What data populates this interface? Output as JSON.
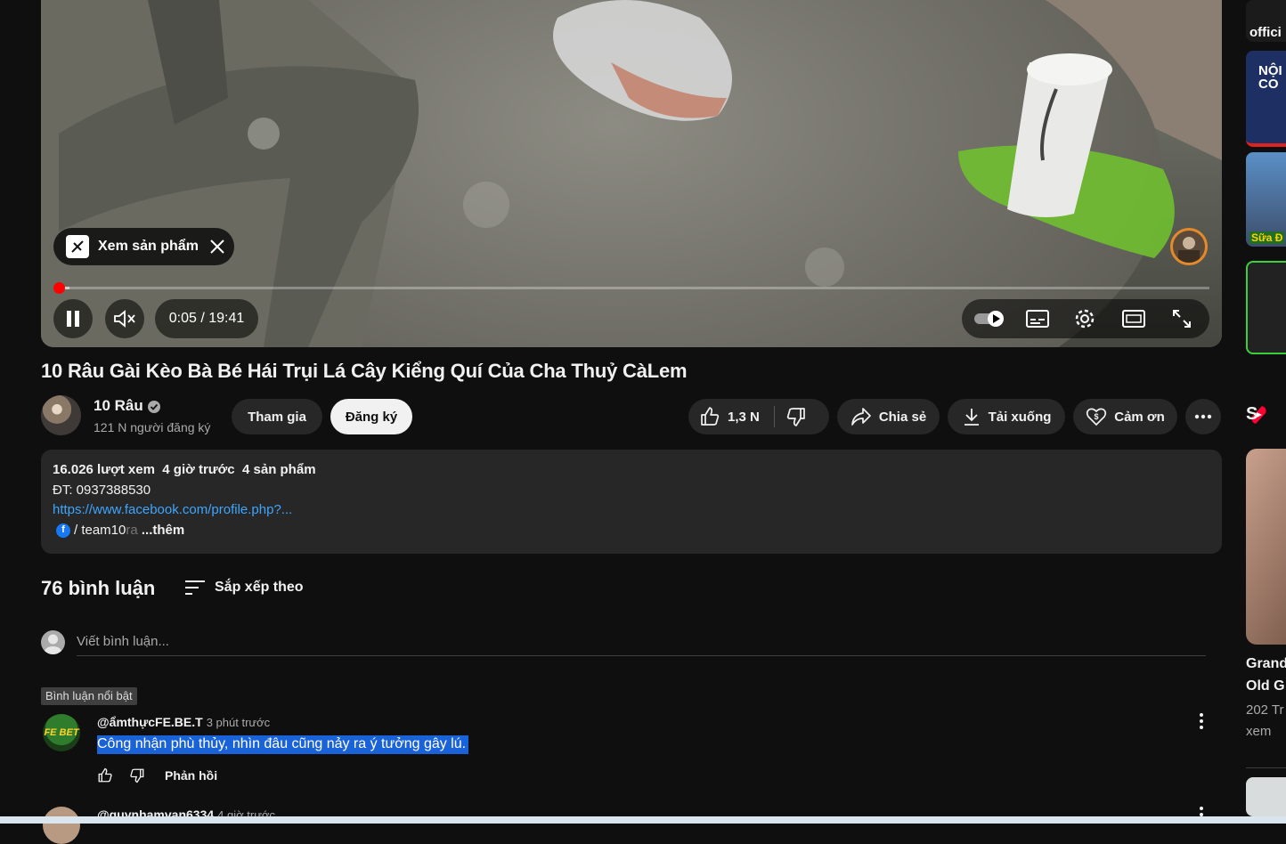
{
  "player": {
    "product_chip_label": "Xem sản phẩm",
    "time_display": "0:05 / 19:41",
    "progress": 0.0043,
    "buffered": 0.012
  },
  "video": {
    "title": "10 Râu Gài Kèo Bà Bé Hái Trụi Lá Cây Kiểng Quí Của Cha Thuỷ CàLem"
  },
  "owner": {
    "channel_name": "10 Râu",
    "subscribers": "121 N người đăng ký",
    "join_label": "Tham gia",
    "subscribe_label": "Đăng ký"
  },
  "actions": {
    "like_count": "1,3 N",
    "share_label": "Chia sẻ",
    "download_label": "Tải xuống",
    "thanks_label": "Cảm ơn"
  },
  "description": {
    "views": "16.026 lượt xem",
    "time_ago": "4 giờ trước",
    "products": "4 sản phẩm",
    "phone_line": "ĐT: 0937388530",
    "link": "https://www.facebook.com/profile.php?...",
    "handle": "/ team10",
    "handle_fade": "ra",
    "more_label": "...thêm"
  },
  "comments": {
    "count_label": "76 bình luận",
    "sort_label": "Sắp xếp theo",
    "input_placeholder": "Viết bình luận...",
    "highlight_badge": "Bình luận nổi bật",
    "items": [
      {
        "author": "@ẩmthựcFE.BE.T",
        "time": "3 phút trước",
        "text": "Công nhận phù thủy, nhìn đâu cũng nảy ra ý tưởng gây lú.",
        "reply_label": "Phản hồi",
        "avatar_text": "FE BET"
      },
      {
        "author": "@quynhamvan6334",
        "time": "4 giờ trước"
      }
    ]
  },
  "sidebar": {
    "thumb1_text": "offici",
    "thumb2_text": "NỘI\nCO",
    "thumb3_text": "Sữa Đ",
    "section_letter": "S",
    "video_title_line1": "Grand",
    "video_title_line2": "Old G",
    "video_views_line1": "202 Tr",
    "video_views_line2": "xem"
  },
  "colors": {
    "background": "#0f0f0f",
    "chip": "#272727",
    "link": "#3ea6ff",
    "progress": "#ff0000",
    "highlight": "#1a62d8"
  }
}
